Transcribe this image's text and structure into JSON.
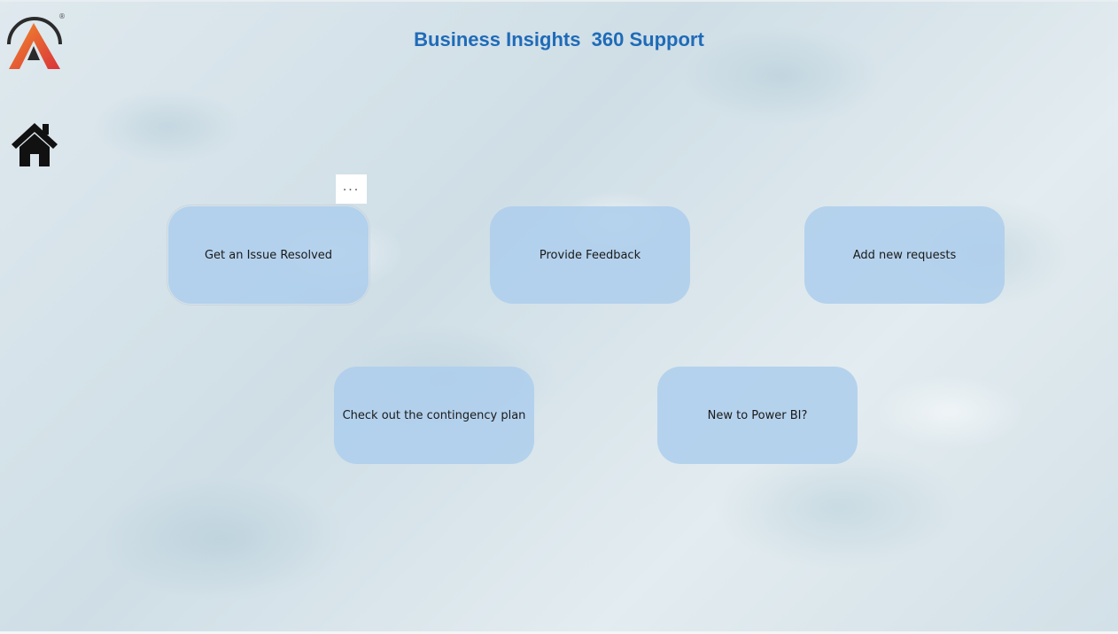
{
  "header": {
    "title": "Business Insights  360 Support",
    "logo_icon": "brand-logo-icon",
    "logo_mark": "®"
  },
  "nav": {
    "home_icon": "home-icon"
  },
  "visual_menu": {
    "icon": "more-options-icon",
    "label": "..."
  },
  "tiles": [
    {
      "label": "Get an Issue Resolved"
    },
    {
      "label": "Provide Feedback"
    },
    {
      "label": "Add new requests"
    },
    {
      "label": "Check out the contingency plan"
    },
    {
      "label": "New to Power BI?"
    }
  ],
  "colors": {
    "title": "#1f6bb8",
    "tile_fill": "#adceec",
    "logo_orange": "#f0702a",
    "logo_red": "#d9343a",
    "logo_dark": "#2b2b2b"
  }
}
